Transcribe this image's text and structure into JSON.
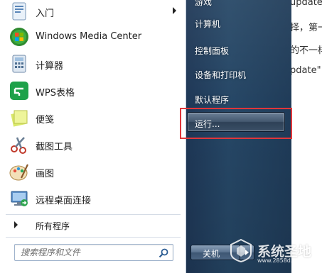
{
  "background_doc": {
    "lines": [
      "update",
      "择，第一",
      "的不一样",
      "pdate\""
    ]
  },
  "left_pane": {
    "programs": [
      {
        "label": "入门",
        "icon": "getting-started-icon",
        "has_submenu": true
      },
      {
        "label": "Windows Media Center",
        "icon": "windows-media-center-icon",
        "has_submenu": false
      },
      {
        "label": "计算器",
        "icon": "calculator-icon",
        "has_submenu": false
      },
      {
        "label": "WPS表格",
        "icon": "wps-spreadsheet-icon",
        "has_submenu": false
      },
      {
        "label": "便笺",
        "icon": "sticky-notes-icon",
        "has_submenu": false
      },
      {
        "label": "截图工具",
        "icon": "snipping-tool-icon",
        "has_submenu": false
      },
      {
        "label": "画图",
        "icon": "paint-icon",
        "has_submenu": false
      },
      {
        "label": "远程桌面连接",
        "icon": "remote-desktop-icon",
        "has_submenu": false
      }
    ],
    "all_programs_label": "所有程序",
    "search_placeholder": "搜索程序和文件"
  },
  "right_pane": {
    "items": [
      {
        "label": "游戏"
      },
      {
        "label": "计算机"
      },
      {
        "label": "控制面板"
      },
      {
        "label": "设备和打印机"
      },
      {
        "label": "默认程序"
      },
      {
        "label": "运行..."
      }
    ],
    "shutdown_label": "关机"
  },
  "watermark": {
    "title": "系统圣地",
    "url": "www.2858d.com"
  },
  "colors": {
    "highlight_border": "#e0363a",
    "right_pane_bg": "#264766"
  }
}
